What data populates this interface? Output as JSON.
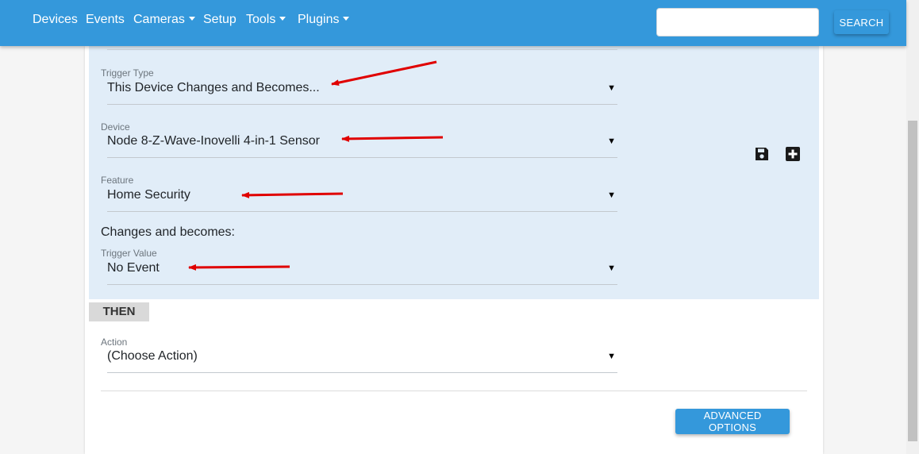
{
  "navbar": {
    "items": [
      {
        "label": "Devices",
        "dropdown": false
      },
      {
        "label": "Events",
        "dropdown": false
      },
      {
        "label": "Cameras",
        "dropdown": true
      },
      {
        "label": "Setup",
        "dropdown": false
      },
      {
        "label": "Tools",
        "dropdown": true
      },
      {
        "label": "Plugins",
        "dropdown": true
      }
    ],
    "search": {
      "value": "",
      "placeholder": "",
      "button_label": "SEARCH"
    },
    "color": "#3498db"
  },
  "trigger": {
    "type": {
      "label": "Trigger Type",
      "value": "This Device Changes and Becomes..."
    },
    "device": {
      "label": "Device",
      "value": "Node 8-Z-Wave-Inovelli 4-in-1 Sensor"
    },
    "feature": {
      "label": "Feature",
      "value": "Home Security"
    },
    "changes_text": "Changes and becomes:",
    "value": {
      "label": "Trigger Value",
      "value": "No Event"
    },
    "icons": [
      "save-icon",
      "plus-square-icon"
    ],
    "panel_color": "#e1edf8"
  },
  "then": {
    "badge": "THEN",
    "action": {
      "label": "Action",
      "value": "(Choose Action)"
    }
  },
  "advanced_button": "ADVANCED OPTIONS",
  "annotation_arrow_color": "#e00000"
}
